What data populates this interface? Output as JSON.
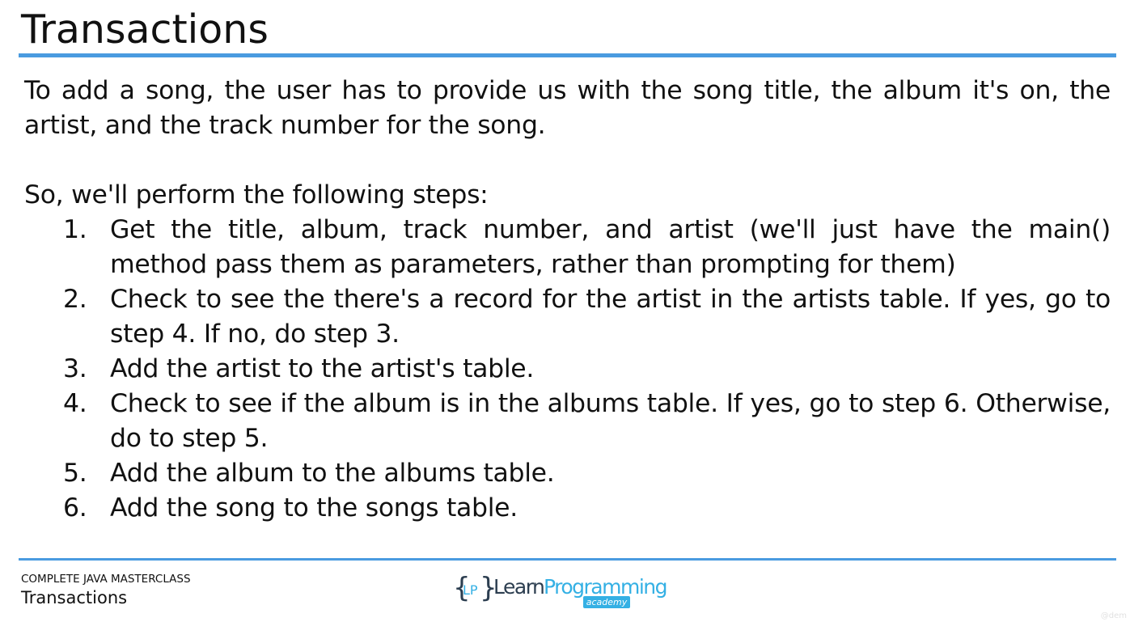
{
  "slide": {
    "title": "Transactions",
    "intro": "To add a song, the user has to provide us with the song title, the album it's on, the artist, and the track number for the song.",
    "steps_heading": "So, we'll perform the following steps:",
    "steps": [
      {
        "number": "1.",
        "text": "Get the title, album, track number, and artist (we'll just have the main() method pass them as parameters, rather than prompting for them)"
      },
      {
        "number": "2.",
        "text": "Check to see the there's a record for the artist in the artists table. If yes, go to step 4. If no, do step 3."
      },
      {
        "number": "3.",
        "text": "Add the artist to the artist's table."
      },
      {
        "number": "4.",
        "text": "Check to see if the album is in the albums table. If yes, go to step 6. Otherwise, do to step 5."
      },
      {
        "number": "5.",
        "text": "Add the album to the albums table."
      },
      {
        "number": "6.",
        "text": "Add the song to the songs table."
      }
    ]
  },
  "footer": {
    "course_name": "COMPLETE JAVA MASTERCLASS",
    "topic": "Transactions",
    "logo": {
      "brace_open": "{",
      "initials": "LP",
      "brace_close": "}",
      "learn": "Learn",
      "programming": "Programming",
      "academy": "academy"
    },
    "watermark": "@dem"
  },
  "colors": {
    "accent_rule": "#4a9be0",
    "text": "#111111",
    "logo_dark": "#2c3e50",
    "logo_blue": "#34b0e4"
  }
}
